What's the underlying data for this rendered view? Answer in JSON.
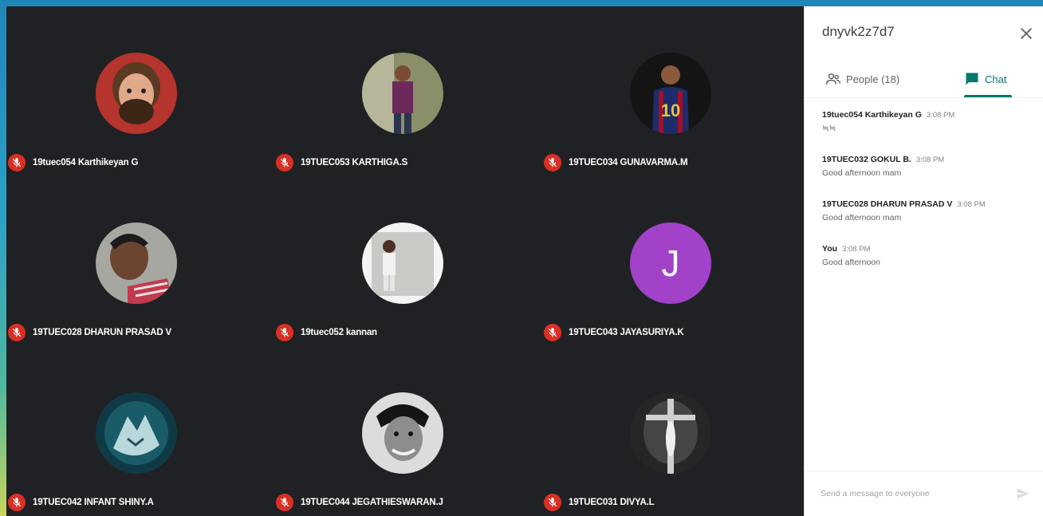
{
  "participants": [
    {
      "name": "19tuec054 Karthikeyan G",
      "avatar": "photo-bearded-man"
    },
    {
      "name": "19TUEC053 KARTHIGA.S",
      "avatar": "photo-man-standing"
    },
    {
      "name": "19TUEC034 GUNAVARMA.M",
      "avatar": "photo-footballer-10"
    },
    {
      "name": "19TUEC028 DHARUN PRASAD V",
      "avatar": "photo-man-selfie"
    },
    {
      "name": "19tuec052 kannan",
      "avatar": "photo-man-wall"
    },
    {
      "name": "19TUEC043 JAYASURIYA.K",
      "avatar_letter": "J",
      "avatar_color": "#a142c9"
    },
    {
      "name": "19TUEC042 INFANT SHINY.A",
      "avatar": "photo-wolf-art"
    },
    {
      "name": "19TUEC044 JEGATHIESWARAN.J",
      "avatar": "photo-man-bw"
    },
    {
      "name": "19TUEC031 DIVYA.L",
      "avatar": "photo-crucifix"
    }
  ],
  "panel": {
    "meeting_code": "dnyvk2z7d7",
    "close_icon": "close-icon",
    "tabs": {
      "people": "People (18)",
      "chat": "Chat"
    },
    "messages": [
      {
        "sender": "19tuec054 Karthikeyan G",
        "time": "3:08 PM",
        "text": "≒≒"
      },
      {
        "sender": "19TUEC032 GOKUL B.",
        "time": "3:08 PM",
        "text": "Good afternoon mam"
      },
      {
        "sender": "19TUEC028 DHARUN PRASAD V",
        "time": "3:08 PM",
        "text": "Good afternoon mam"
      },
      {
        "sender": "You",
        "time": "3:08 PM",
        "text": "Good afternoon"
      }
    ],
    "composer_placeholder": "Send a message to everyone",
    "accent_color": "#00796b",
    "mute_color": "#d93025"
  }
}
